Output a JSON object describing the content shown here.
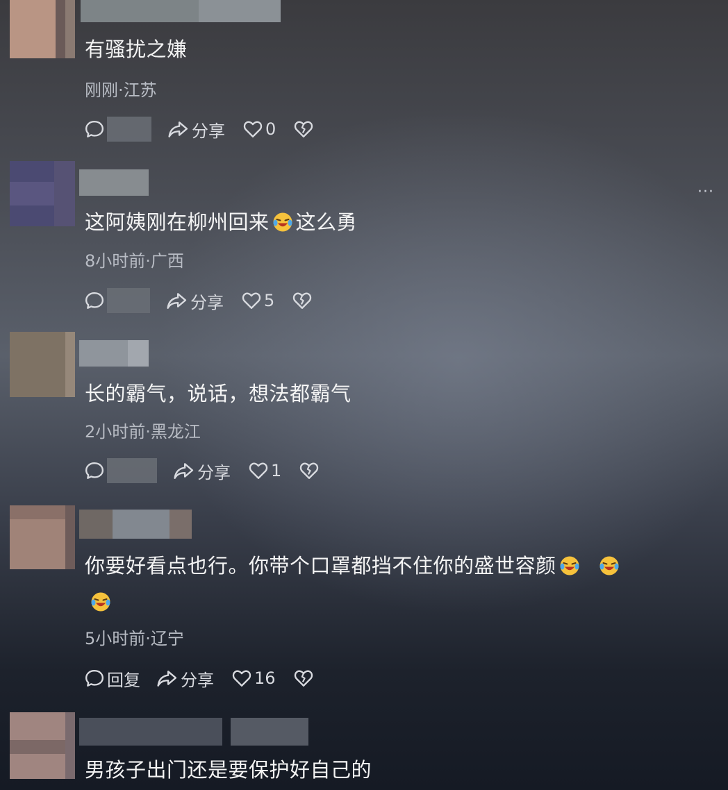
{
  "comments": [
    {
      "text": "有骚扰之嫌",
      "meta": "刚刚·江苏",
      "reply_label": "",
      "share_label": "分享",
      "like_count": "0"
    },
    {
      "text_before": "这阿姨刚在柳州回来",
      "text_after": "这么勇",
      "meta": "8小时前·广西",
      "reply_label": "",
      "share_label": "分享",
      "like_count": "5"
    },
    {
      "text": "长的霸气，说话，想法都霸气",
      "meta": "2小时前·黑龙江",
      "reply_label": "",
      "share_label": "分享",
      "like_count": "1"
    },
    {
      "text": "你要好看点也行。你带个口罩都挡不住你的盛世容颜",
      "meta": "5小时前·辽宁",
      "reply_label": "回复",
      "share_label": "分享",
      "like_count": "16"
    },
    {
      "text": "男孩子出门还是要保护好自己的"
    }
  ],
  "more_label": "···",
  "icons": {
    "reply": "comment-bubble-icon",
    "share": "share-arrow-icon",
    "like": "heart-icon",
    "dislike": "broken-heart-icon",
    "emoji": "laughing-crying-emoji-icon"
  },
  "colors": {
    "text": "#f4f4f4",
    "meta": "#b8bcc4",
    "action": "#d8dadf"
  }
}
